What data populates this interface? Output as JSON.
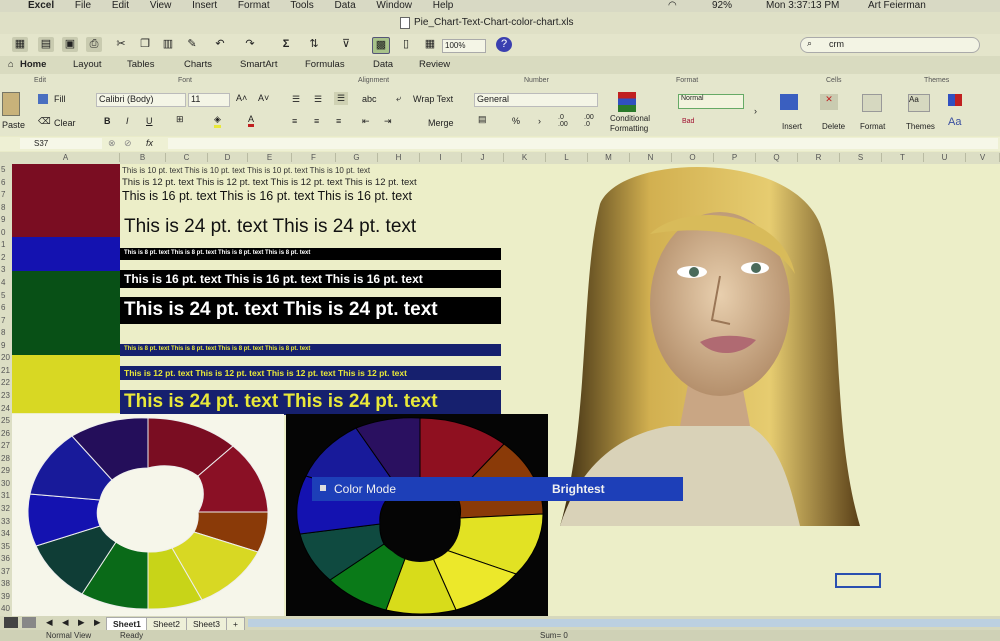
{
  "menu": [
    "Excel",
    "File",
    "Edit",
    "View",
    "Insert",
    "Format",
    "Tools",
    "Data",
    "Window",
    "Help"
  ],
  "status_right": {
    "battery": "92%",
    "clock": "Mon 3:37:13 PM",
    "user": "Art Feierman"
  },
  "doc_title": "Pie_Chart-Text-Chart-color-chart.xls",
  "zoom": "100%",
  "search_value": "crm",
  "ribbon_tabs": [
    "Home",
    "Layout",
    "Tables",
    "Charts",
    "SmartArt",
    "Formulas",
    "Data",
    "Review"
  ],
  "ribbon": {
    "groups": {
      "edit": "Edit",
      "font": "Font",
      "alignment": "Alignment",
      "number": "Number",
      "format": "Format",
      "cells": "Cells",
      "themes": "Themes"
    },
    "paste": "Paste",
    "fill": "Fill",
    "clear": "Clear",
    "font_name": "Calibri (Body)",
    "font_size": "11",
    "wrap_text": "Wrap Text",
    "abc": "abc",
    "merge": "Merge",
    "number_format": "General",
    "percent": "%",
    "cond_format_1": "Conditional",
    "cond_format_2": "Formatting",
    "style_normal": "Normal",
    "style_bad": "Bad",
    "insert": "Insert",
    "delete": "Delete",
    "format_btn": "Format",
    "themes_btn": "Themes",
    "aa": "Aa"
  },
  "formula_bar": {
    "cell": "S37",
    "fx": "fx"
  },
  "columns": [
    "A",
    "B",
    "C",
    "D",
    "E",
    "F",
    "G",
    "H",
    "I",
    "J",
    "K",
    "L",
    "M",
    "N",
    "O",
    "P",
    "Q",
    "R",
    "S",
    "T",
    "U",
    "V"
  ],
  "rows": [
    "5",
    "6",
    "7",
    "8",
    "9",
    "0",
    "1",
    "2",
    "3",
    "4",
    "5",
    "6",
    "7",
    "8",
    "9",
    "20",
    "21",
    "22",
    "23",
    "24",
    "25",
    "26",
    "27",
    "28",
    "29",
    "30",
    "31",
    "32",
    "33",
    "34",
    "35",
    "36",
    "37",
    "38",
    "39",
    "40"
  ],
  "swatches": [
    {
      "color": "#7a0d22"
    },
    {
      "color": "#1412b0"
    },
    {
      "color": "#085016"
    },
    {
      "color": "#d8d823"
    }
  ],
  "text_rows": {
    "r10": "This is 10 pt. text   This is 10 pt. text   This is 10 pt. text   This is 10 pt. text",
    "r12": "This is 12 pt. text   This is 12 pt. text   This is 12 pt. text   This is 12 pt. text",
    "r16": "This is 16 pt. text   This is 16 pt. text   This is 16 pt. text",
    "r24": "This is 24 pt. text   This is 24 pt. text",
    "b8": "This is 8 pt. text   This is 8 pt. text   This is 8 pt. text   This is 8 pt. text",
    "b16": "This is 16 pt. text   This is 16 pt. text   This is 16 pt. text",
    "b24": "This is 24 pt. text   This is 24 pt. text",
    "n8": "This is 8 pt. text   This is 8 pt. text   This is 8 pt. text   This is 8 pt. text",
    "n12": "This is 12 pt. text   This is 12 pt. text   This is 12 pt. text   This is 12 pt. text",
    "n24": "This is 24 pt. text   This is 24 pt. text"
  },
  "colors": {
    "dark_red": "#7a0d22",
    "red": "#8f1020",
    "blue": "#1412b0",
    "navy": "#16206e",
    "green": "#085016",
    "teal": "#0f3d36",
    "yellow": "#d8d823",
    "yellow_green": "#b7cc1a",
    "orange": "#8a3a08",
    "purple": "#240e5a",
    "osd_blue": "#1d3fb8",
    "highlight_yellow": "#e8e83a"
  },
  "osd": {
    "label": "Color Mode",
    "value": "Brightest"
  },
  "sheet_tabs": [
    "Sheet1",
    "Sheet2",
    "Sheet3",
    "+"
  ],
  "status_bar": {
    "view": "Normal View",
    "state": "Ready",
    "sum": "Sum= 0"
  }
}
